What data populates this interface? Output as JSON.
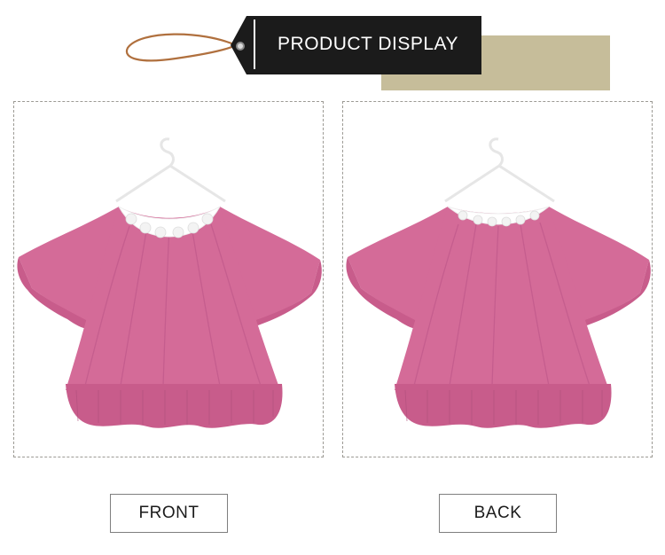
{
  "header": {
    "title": "PRODUCT DISPLAY",
    "tag_color": "#1b1b1b",
    "shadow_color": "#c6bd9a",
    "string_color": "#b0703e"
  },
  "views": [
    {
      "caption": "FRONT",
      "garment_color": "#d46b98",
      "lace_color": "#ffffff"
    },
    {
      "caption": "BACK",
      "garment_color": "#d46b98",
      "lace_color": "#ffffff"
    }
  ]
}
